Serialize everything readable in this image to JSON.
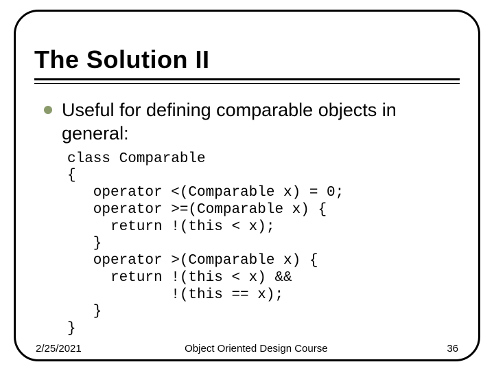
{
  "title": "The Solution II",
  "bullet": "Useful for defining comparable objects in general:",
  "code": "class Comparable\n{\n   operator <(Comparable x) = 0;\n   operator >=(Comparable x) {\n     return !(this < x);\n   }\n   operator >(Comparable x) {\n     return !(this < x) &&\n            !(this == x);\n   }\n}",
  "footer": {
    "date": "2/25/2021",
    "course": "Object Oriented Design Course",
    "page": "36"
  }
}
